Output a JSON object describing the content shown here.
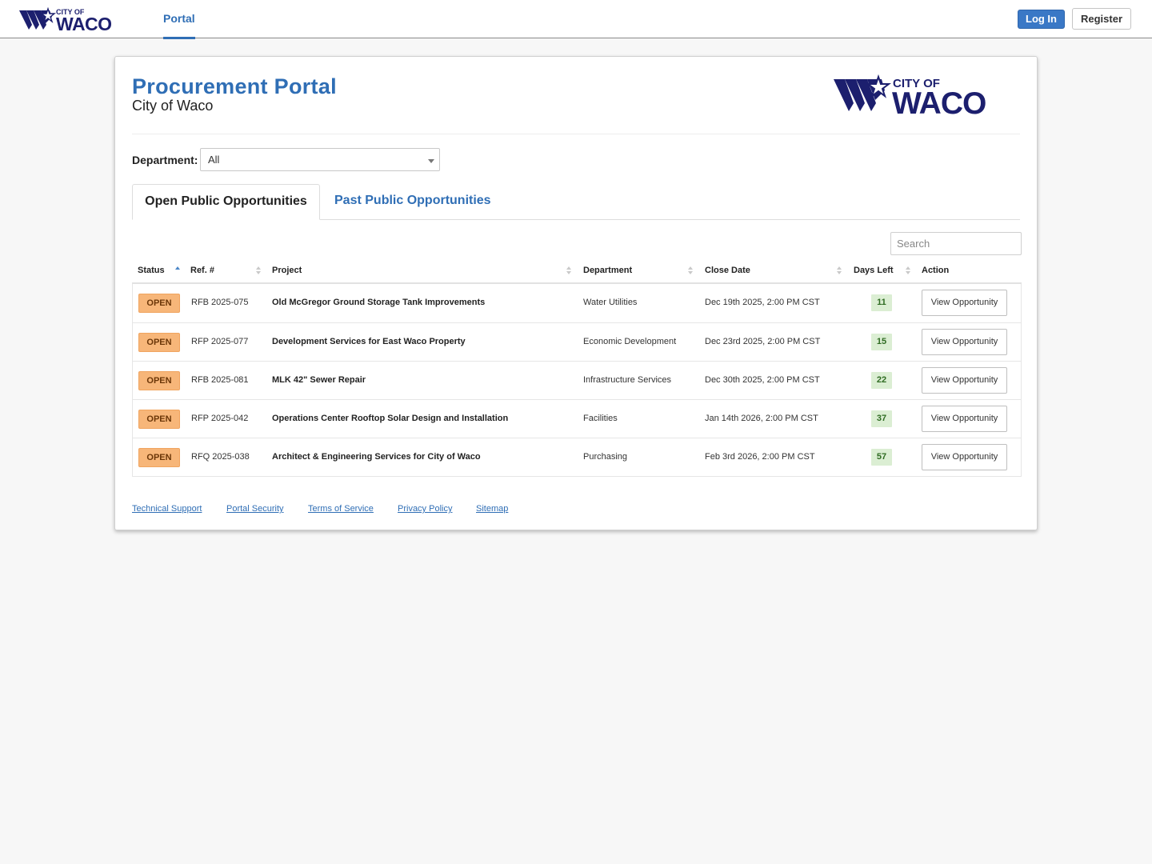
{
  "topbar": {
    "logo_small": "CITY OF",
    "logo_big": "WACO",
    "nav_portal": "Portal",
    "login_label": "Log In",
    "register_label": "Register"
  },
  "header": {
    "title": "Procurement Portal",
    "subtitle": "City of Waco",
    "logo_small": "CITY OF",
    "logo_big": "WACO"
  },
  "filter": {
    "department_label": "Department:",
    "department_value": "All"
  },
  "tabs": {
    "open": "Open Public Opportunities",
    "past": "Past Public Opportunities"
  },
  "search": {
    "placeholder": "Search"
  },
  "table": {
    "headers": {
      "status": "Status",
      "ref": "Ref. #",
      "project": "Project",
      "department": "Department",
      "close_date": "Close Date",
      "days_left": "Days Left",
      "action": "Action"
    },
    "rows": [
      {
        "status": "OPEN",
        "ref": "RFB 2025-075",
        "project": "Old McGregor Ground Storage Tank Improvements",
        "department": "Water Utilities",
        "close_date": "Dec 19th 2025, 2:00 PM CST",
        "days_left": "11",
        "action": "View Opportunity"
      },
      {
        "status": "OPEN",
        "ref": "RFP 2025-077",
        "project": "Development Services for East Waco Property",
        "department": "Economic Development",
        "close_date": "Dec 23rd 2025, 2:00 PM CST",
        "days_left": "15",
        "action": "View Opportunity"
      },
      {
        "status": "OPEN",
        "ref": "RFB 2025-081",
        "project": "MLK 42\" Sewer Repair",
        "department": "Infrastructure Services",
        "close_date": "Dec 30th 2025, 2:00 PM CST",
        "days_left": "22",
        "action": "View Opportunity"
      },
      {
        "status": "OPEN",
        "ref": "RFP 2025-042",
        "project": "Operations Center Rooftop Solar Design and Installation",
        "department": "Facilities",
        "close_date": "Jan 14th 2026, 2:00 PM CST",
        "days_left": "37",
        "action": "View Opportunity"
      },
      {
        "status": "OPEN",
        "ref": "RFQ 2025-038",
        "project": "Architect & Engineering Services for City of Waco",
        "department": "Purchasing",
        "close_date": "Feb 3rd 2026, 2:00 PM CST",
        "days_left": "57",
        "action": "View Opportunity"
      }
    ]
  },
  "footer": {
    "links": [
      "Technical Support",
      "Portal Security",
      "Terms of Service",
      "Privacy Policy",
      "Sitemap"
    ]
  },
  "colors": {
    "brand_blue": "#2f6eb5",
    "logo_navy": "#1c1f6e",
    "open_badge": "#f7b679",
    "days_badge": "#dbeed3"
  }
}
